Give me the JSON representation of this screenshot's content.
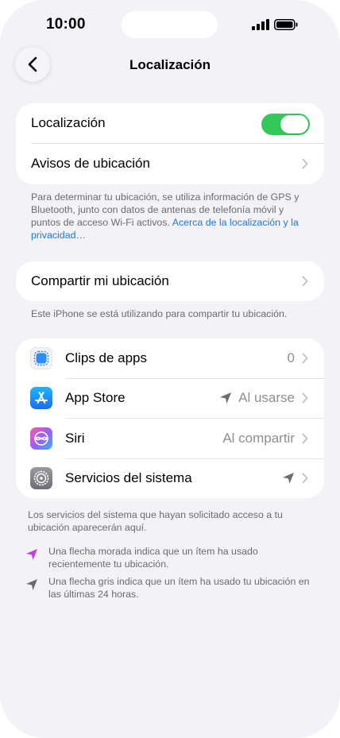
{
  "status_bar": {
    "time": "10:00"
  },
  "nav": {
    "title": "Localización",
    "back_icon": "chevron-left-icon"
  },
  "location_card": {
    "toggle_label": "Localización",
    "toggle_on": true,
    "toggle_color": "#34c759",
    "alerts_label": "Avisos de ubicación"
  },
  "info_note": {
    "text": "Para determinar tu ubicación, se utiliza información de GPS y Bluetooth, junto con datos de antenas de telefonía móvil y puntos de acceso Wi‑Fi activos. ",
    "link": "Acerca de la localización y la privacidad…",
    "link_color": "#1f7ae0"
  },
  "share_card": {
    "label": "Compartir mi ubicación"
  },
  "share_note": "Este iPhone se está utilizando para compartir tu ubicación.",
  "apps": [
    {
      "name": "Clips de apps",
      "value": "0",
      "icon": "app-clips-icon",
      "arrow": false
    },
    {
      "name": "App Store",
      "value": "Al usarse",
      "icon": "app-store-icon",
      "arrow": true
    },
    {
      "name": "Siri",
      "value": "Al compartir",
      "icon": "siri-icon",
      "arrow": false
    },
    {
      "name": "Servicios del sistema",
      "value": "",
      "icon": "settings-gear-icon",
      "arrow": true
    }
  ],
  "system_note": "Los servicios del sistema que hayan solicitado acceso a tu ubicación aparecerán aquí.",
  "legend": [
    {
      "icon": "purple-arrow-icon",
      "color": "#c13fe0",
      "text": "Una flecha morada indica que un ítem ha usado recientemente tu ubicación."
    },
    {
      "icon": "gray-arrow-icon",
      "color": "#6b6b70",
      "text": "Una flecha gris indica que un ítem ha usado tu ubicación en las últimas 24 horas."
    }
  ]
}
